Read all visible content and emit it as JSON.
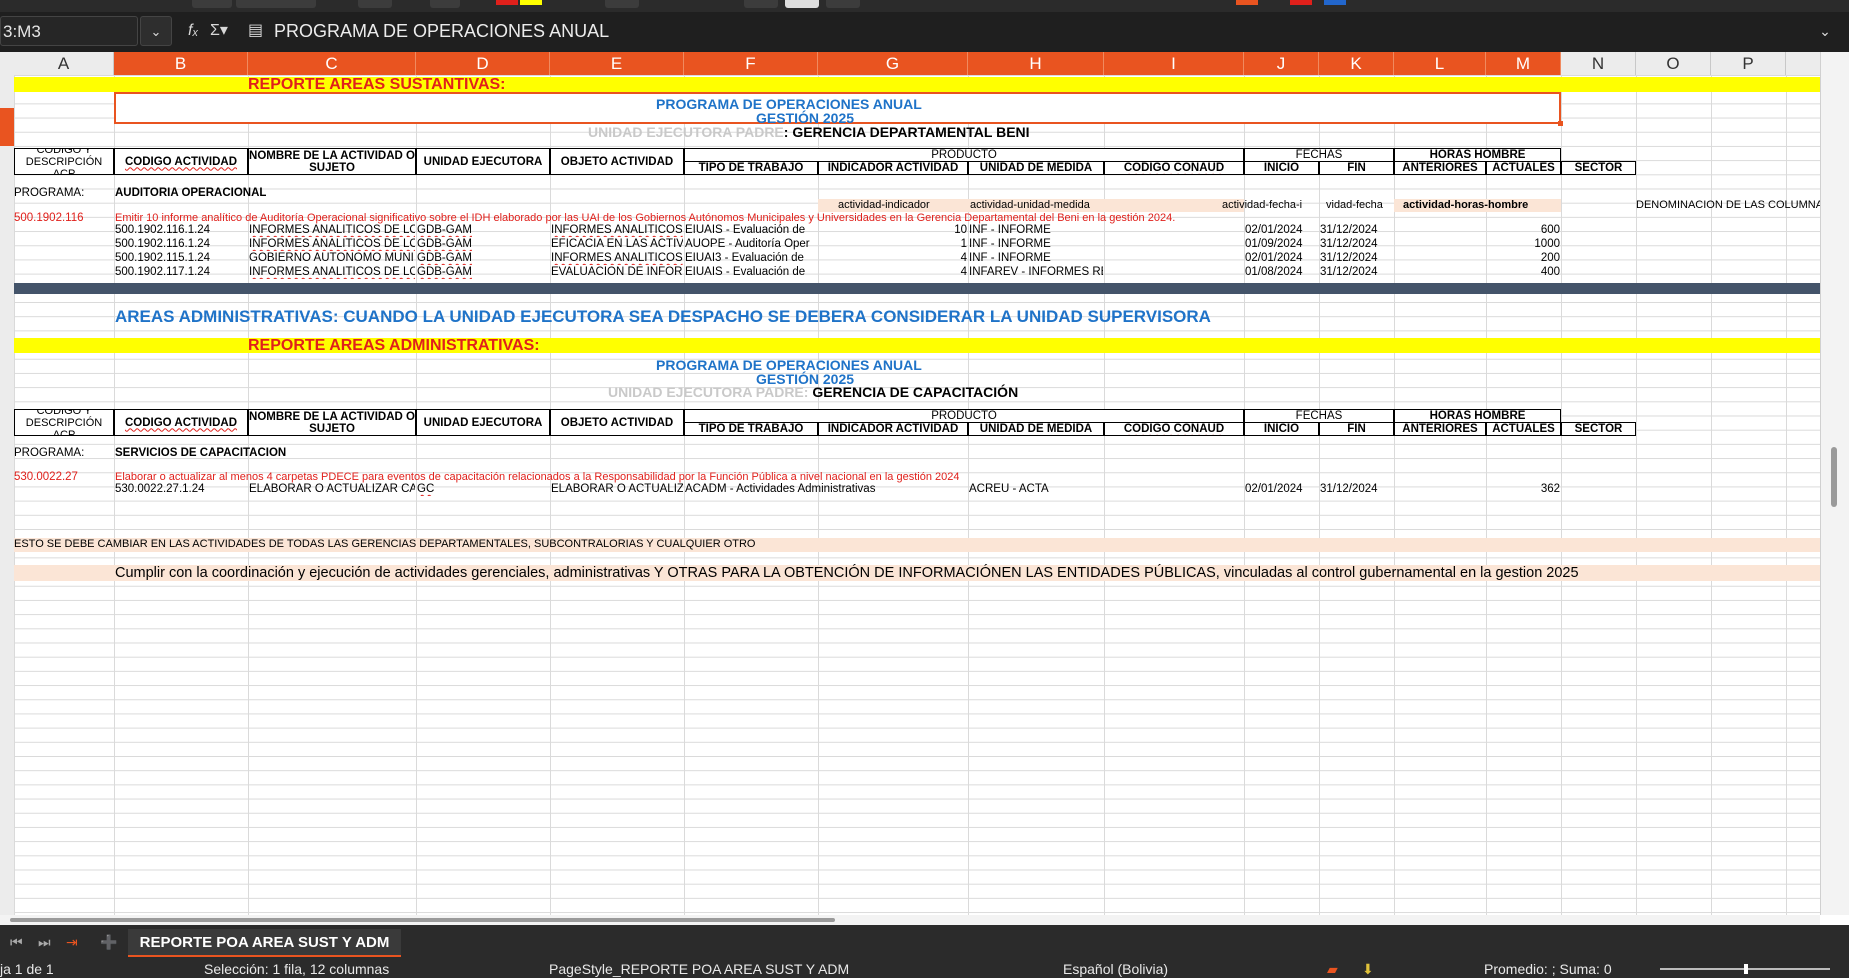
{
  "toolbar": {
    "swatch_red": "#e0201b",
    "swatch_yellow": "#ffff00",
    "swatch_orange": "#e95420",
    "swatch_blue": "#2266cc"
  },
  "formula_bar": {
    "name_box": "3:M3",
    "name_box_dropdown_icon": "chevron-down-icon",
    "function_wizard_icon": "function-wizard-icon",
    "sum_icon": "Σ",
    "formula_icon": "formula-icon",
    "content": "PROGRAMA DE OPERACIONES ANUAL",
    "expand_icon": "chevron-down-icon"
  },
  "columns": [
    "A",
    "B",
    "C",
    "D",
    "E",
    "F",
    "G",
    "H",
    "I",
    "J",
    "K",
    "L",
    "M",
    "N",
    "O",
    "P"
  ],
  "accent": "#e95420",
  "sust": {
    "report_title": "REPORTE AREAS SUSTANTIVAS:",
    "program_title": "PROGRAMA DE OPERACIONES ANUAL",
    "gestion": "GESTIÓN 2025",
    "unidad_label": "UNIDAD EJECUTORA PADRE",
    "unidad_value": ": GERENCIA DEPARTAMENTAL BENI",
    "header": {
      "codigo_desc": "CODIGO Y DESCRIPCIÓN ACP",
      "codigo_actividad": "CODIGO ACTIVIDAD",
      "nombre": "NOMBRE DE LA ACTIVIDAD O SUJETO",
      "unidad_ejecutora": "UNIDAD EJECUTORA",
      "objeto": "OBJETO ACTIVIDAD",
      "producto": "PRODUCTO",
      "tipo_trabajo": "TIPO DE TRABAJO",
      "indicador": "INDICADOR ACTIVIDAD",
      "unidad_medida": "UNIDAD DE MEDIDA",
      "codigo_conaud": "CODIGO CONAUD",
      "fechas": "FECHAS",
      "inicio": "INICIO",
      "fin": "FIN",
      "horas_hombre": "HORAS HOMBRE",
      "anteriores": "ANTERIORES",
      "actuales": "ACTUALES",
      "sector": "SECTOR"
    },
    "programa_label": "PROGRAMA:",
    "programa_value": "AUDITORIA OPERACIONAL",
    "tags": {
      "indicador": "actividad-indicador",
      "unidad_medida": "actividad-unidad-medida",
      "fecha_inicio": "actividad-fecha-i",
      "fecha_fin": "vidad-fecha",
      "horas": "actividad-horas-hombre",
      "denominacion": "DENOMINACION DE LAS COLUMNA"
    },
    "acp_code": "500.1902.116",
    "acp_desc": "Emitir 10 informe analítico de Auditoría Operacional significativo sobre el IDH elaborado por las UAI de los Gobiernos Autónomos Municipales y Universidades en la Gerencia Departamental del Beni en la gestión 2024.",
    "rows": [
      {
        "code": "500.1902.116.1.24",
        "nombre": "INFORMES ANALITICOS DE LO",
        "unidad": "GDB-GAM",
        "objeto": "INFORMES ANALITICOS",
        "tipo": "EIUAIS - Evaluación de",
        "indicador": "10",
        "medida": "INF - INFORME",
        "inicio": "02/01/2024",
        "fin": "31/12/2024",
        "actuales": "600"
      },
      {
        "code": "500.1902.116.1.24",
        "nombre": "INFORMES ANALITICOS DE LO",
        "unidad": "GDB-GAM",
        "objeto": "EFICACIA EN LAS ACTIV",
        "tipo": "AUOPE - Auditoría Oper",
        "indicador": "1",
        "medida": "INF - INFORME",
        "inicio": "01/09/2024",
        "fin": "31/12/2024",
        "actuales": "1000"
      },
      {
        "code": "500.1902.115.1.24",
        "nombre": "GOBIERNO AUTÓNOMO MUNI",
        "unidad": "GDB-GAM",
        "objeto": "INFORMES ANALITICOS",
        "tipo": "EIUAI3 - Evaluación de",
        "indicador": "4",
        "medida": "INF - INFORME",
        "inicio": "02/01/2024",
        "fin": "31/12/2024",
        "actuales": "200"
      },
      {
        "code": "500.1902.117.1.24",
        "nombre": "INFORMES ANALITICOS DE LO",
        "unidad": "GDB-GAM",
        "objeto": "EVALUACIÓN DE INFOR",
        "tipo": "EIUAIS - Evaluación de",
        "indicador": "4",
        "medida": "INFAREV - INFORMES REVISADOS",
        "inicio": "01/08/2024",
        "fin": "31/12/2024",
        "actuales": "400"
      }
    ]
  },
  "adm": {
    "banner": "AREAS ADMINISTRATIVAS: CUANDO LA UNIDAD EJECUTORA SEA DESPACHO SE DEBERA CONSIDERAR LA UNIDAD SUPERVISORA",
    "report_title": "REPORTE AREAS ADMINISTRATIVAS:",
    "program_title": "PROGRAMA DE OPERACIONES ANUAL",
    "gestion": "GESTIÓN 2025",
    "unidad_label": "UNIDAD EJECUTORA PADRE:",
    "unidad_value": "GERENCIA DE CAPACITACIÓN",
    "programa_label": "PROGRAMA:",
    "programa_value": "SERVICIOS DE CAPACITACIÓN",
    "acp_code": "530.0022.27",
    "acp_desc": "Elaborar o actualizar al menos 4 carpetas PDECE para eventos de capacitación relacionados a la Responsabilidad por la Función Pública a nivel nacional en la gestión 2024",
    "row": {
      "code": "530.0022.27.1.24",
      "nombre": "ELABORAR O ACTUALIZAR CA",
      "unidad": "GC",
      "objeto": "ELABORAR O ACTUALIZ",
      "tipo": "ACADM - Actividades Administrativas",
      "medida": "ACREU - ACTA",
      "inicio": "02/01/2024",
      "fin": "31/12/2024",
      "actuales": "362"
    }
  },
  "notes": {
    "change_note": "ESTO SE DEBE CAMBIAR EN LAS ACTIVIDADES DE TODAS LAS GERENCIAS DEPARTAMENTALES, SUBCONTRALORIAS Y CUALQUIER OTRO",
    "goal": "Cumplir con la coordinación y ejecución de actividades gerenciales, administrativas Y OTRAS PARA LA OBTENCIÓN DE INFORMACIÓNEN LAS ENTIDADES PÚBLICAS, vinculadas al control gubernamental en la gestion 2025"
  },
  "tabs": {
    "sheet_name": "REPORTE POA AREA SUST Y ADM",
    "first_icon": "first-sheet-icon",
    "last_icon": "last-sheet-icon",
    "add_icon": "add-sheet-icon"
  },
  "status": {
    "sheet": "ja 1 de 1",
    "selection": "Selección: 1 fila, 12 columnas",
    "page_style": "PageStyle_REPORTE POA AREA SUST Y ADM",
    "language": "Español (Bolivia)",
    "summary": "Promedio: ; Suma: 0"
  }
}
